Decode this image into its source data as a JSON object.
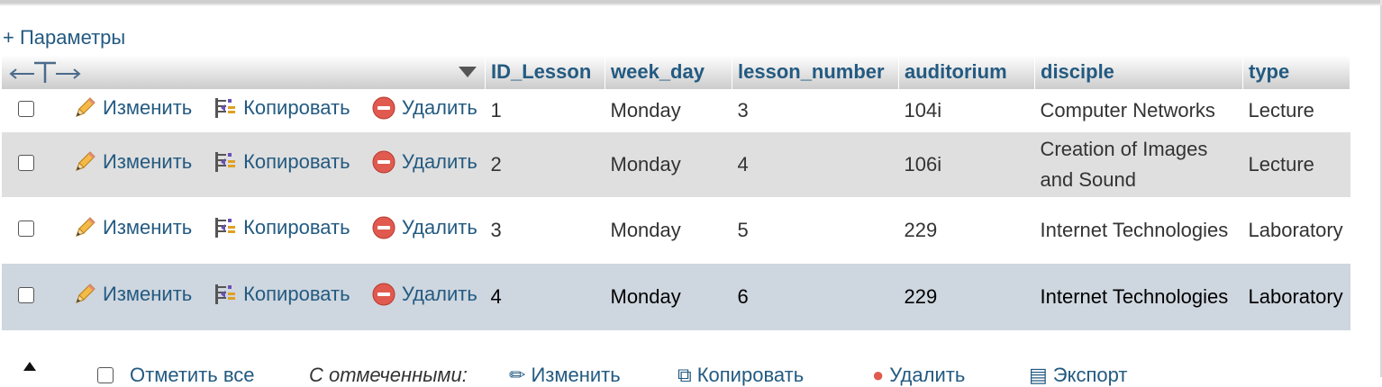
{
  "options_link": "+ Параметры",
  "columns": [
    "ID_Lesson",
    "week_day",
    "lesson_number",
    "auditorium",
    "disciple",
    "type"
  ],
  "actions": {
    "edit": "Изменить",
    "copy": "Копировать",
    "delete": "Удалить"
  },
  "rows": [
    {
      "id": "1",
      "week_day": "Monday",
      "lesson_number": "3",
      "auditorium": "104i",
      "disciple": "Computer Networks",
      "type": "Lecture"
    },
    {
      "id": "2",
      "week_day": "Monday",
      "lesson_number": "4",
      "auditorium": "106i",
      "disciple": "Creation of Images and Sound",
      "type": "Lecture"
    },
    {
      "id": "3",
      "week_day": "Monday",
      "lesson_number": "5",
      "auditorium": "229",
      "disciple": "Internet Technologies",
      "type": "Laboratory"
    },
    {
      "id": "4",
      "week_day": "Monday",
      "lesson_number": "6",
      "auditorium": "229",
      "disciple": "Internet Technologies",
      "type": "Laboratory"
    }
  ],
  "footer": {
    "check_all": "Отметить все",
    "with_selected": "С отмеченными:",
    "edit": "Изменить",
    "copy": "Копировать",
    "delete": "Удалить",
    "export": "Экспорт"
  },
  "colors": {
    "link": "#235a81",
    "row_even": "#dfdfdf",
    "row_hover": "#ced6df",
    "delete_icon": "#e05a4f"
  }
}
